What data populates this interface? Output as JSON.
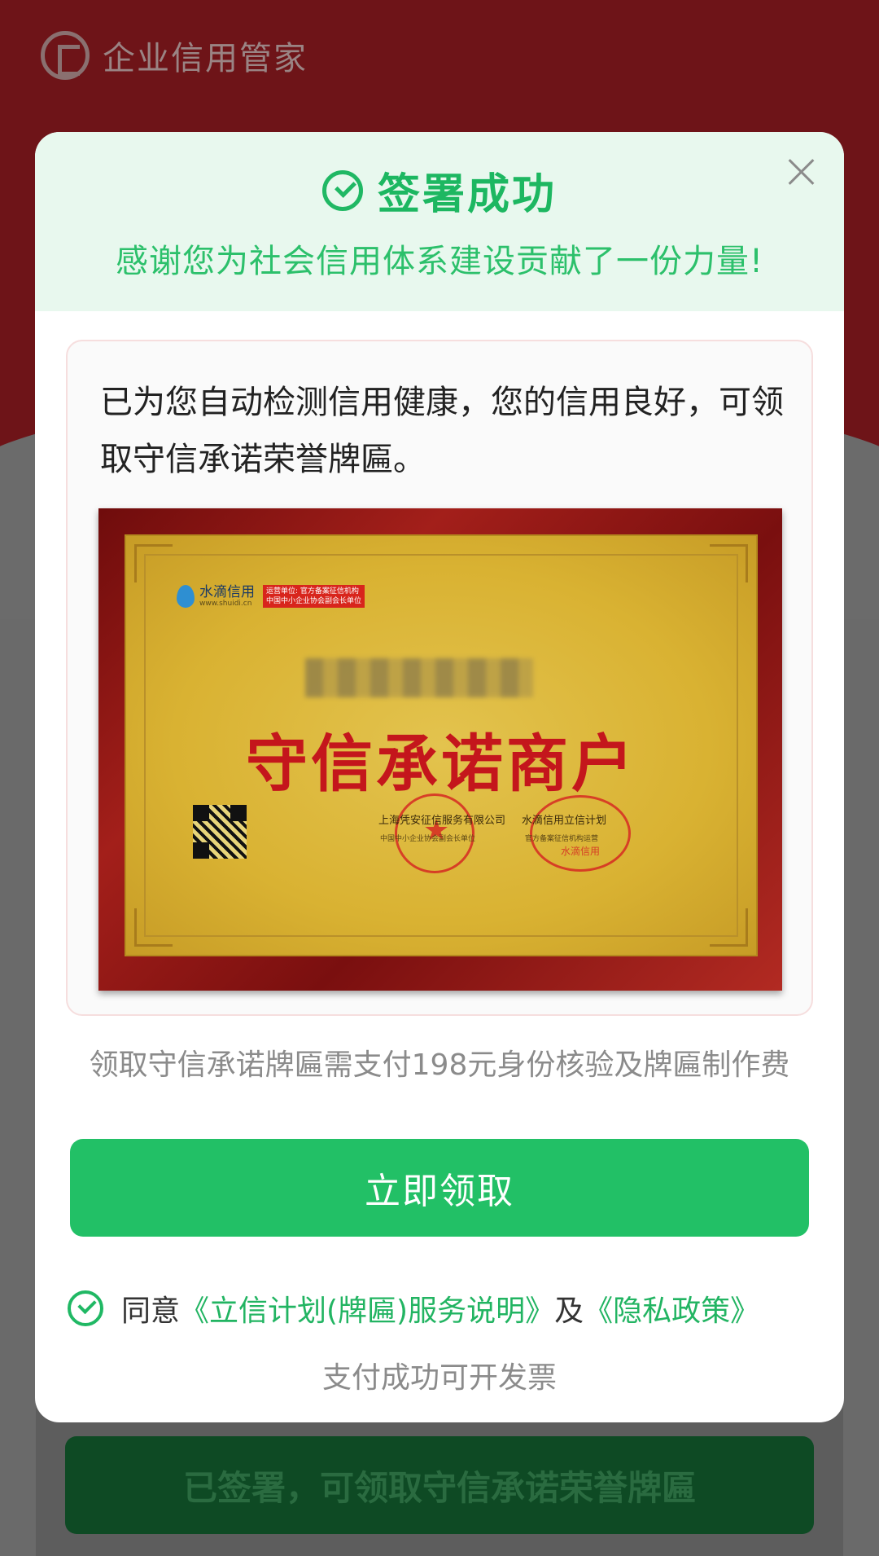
{
  "background": {
    "app_name": "企业信用管家",
    "bottom_button_label": "已签署，可领取守信承诺荣誉牌匾"
  },
  "modal": {
    "title": "签署成功",
    "subtitle": "感谢您为社会信用体系建设贡献了一份力量!",
    "info_text": "已为您自动检测信用健康，您的信用良好，可领取守信承诺荣誉牌匾。",
    "plaque": {
      "brand": "水滴信用",
      "url": "www.shuidi.cn",
      "badge_line1": "运营单位: 官方备案征信机构",
      "badge_line2": "中国中小企业协会副会长单位",
      "title": "守信承诺商户",
      "org_left": "上海凭安征信服务有限公司",
      "org_right": "水滴信用立信计划",
      "sub_left": "中国中小企业协会副会长单位",
      "sub_right": "官方备案征信机构运营",
      "seal_right": "水滴信用"
    },
    "fee_text": "领取守信承诺牌匾需支付198元身份核验及牌匾制作费",
    "claim_button": "立即领取",
    "agree": {
      "prefix": "同意",
      "link1": "《立信计划(牌匾)服务说明》",
      "and": "及",
      "link2": "《隐私政策》"
    },
    "invoice_text": "支付成功可开发票"
  },
  "colors": {
    "accent_green": "#22c066",
    "header_bg": "#e8f8ee",
    "bg_red": "#6e1418"
  }
}
